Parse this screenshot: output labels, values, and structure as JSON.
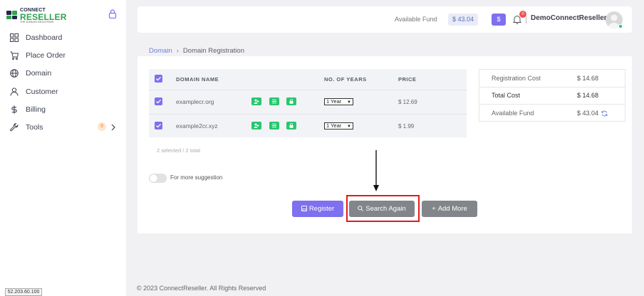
{
  "brand": {
    "line1": "CONNECT",
    "line2": "RESELLER",
    "tagline": "THE DOMAIN REGISTRAR"
  },
  "sidebar": {
    "items": [
      {
        "label": "Dashboard",
        "icon": "grid-icon"
      },
      {
        "label": "Place Order",
        "icon": "cart-icon"
      },
      {
        "label": "Domain",
        "icon": "globe-icon"
      },
      {
        "label": "Customer",
        "icon": "user-icon"
      },
      {
        "label": "Billing",
        "icon": "dollar-icon"
      },
      {
        "label": "Tools",
        "icon": "wrench-icon",
        "badge": "9"
      }
    ]
  },
  "header": {
    "available_fund_label": "Available Fund",
    "available_fund_value": "$ 43.04",
    "fund_button": "$",
    "notification_count": "0",
    "username": "DemoConnectReseller"
  },
  "breadcrumb": {
    "parent": "Domain",
    "current": "Domain Registration"
  },
  "table": {
    "headers": {
      "domain": "DOMAIN NAME",
      "years": "NO. OF YEARS",
      "price": "PRICE"
    },
    "rows": [
      {
        "domain": "examplecr.org",
        "years": "1 Year",
        "price": "$ 12.69"
      },
      {
        "domain": "example2cr.xyz",
        "years": "1 Year",
        "price": "$ 1.99"
      }
    ],
    "selection_count": "2 selected / 2 total"
  },
  "suggestion_toggle_label": "For more suggestion",
  "buttons": {
    "register": "Register",
    "search_again": "Search Again",
    "add_more": "Add More"
  },
  "summary": {
    "registration_cost_label": "Registration Cost",
    "registration_cost_value": "$ 14.68",
    "total_cost_label": "Total Cost",
    "total_cost_value": "$ 14.68",
    "available_fund_label": "Available Fund",
    "available_fund_value": "$ 43.04"
  },
  "footer": "© 2023 ConnectReseller. All Rights Reserved",
  "ip_label": "52.203.60.100",
  "colors": {
    "accent": "#7e70ee",
    "success": "#28c76f",
    "highlight": "#e01b1b"
  }
}
